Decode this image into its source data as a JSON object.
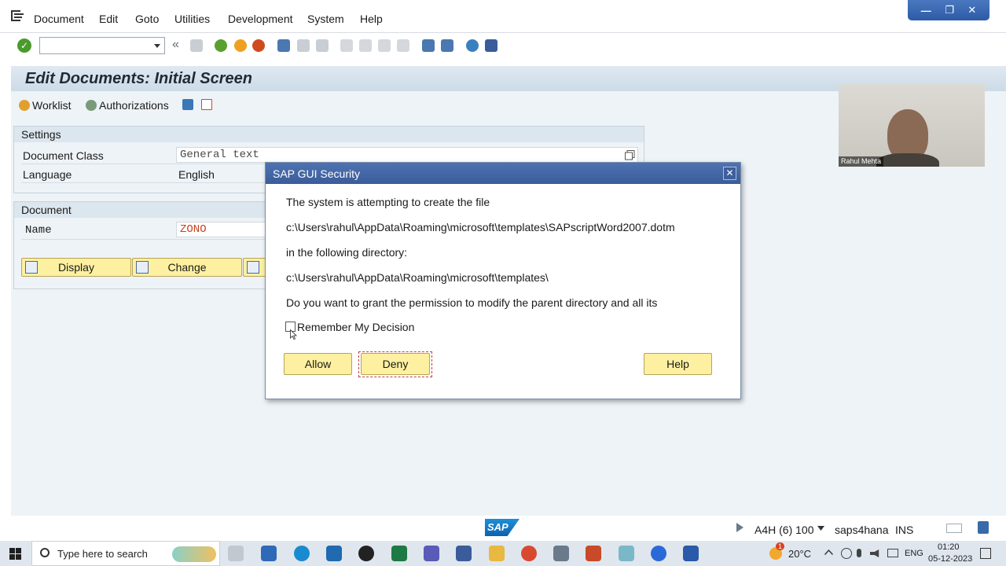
{
  "menu": {
    "items": [
      "Document",
      "Edit",
      "Goto",
      "Utilities",
      "Development",
      "System",
      "Help"
    ]
  },
  "window_controls": {
    "minimize": "—",
    "restore": "❐",
    "close": "✕"
  },
  "toolbar": {
    "command_field_value": "",
    "back_glyph": "«"
  },
  "screen": {
    "title": "Edit Documents: Initial Screen",
    "app_toolbar": {
      "worklist": "Worklist",
      "authorizations": "Authorizations"
    },
    "settings": {
      "header": "Settings",
      "document_class_label": "Document Class",
      "document_class_value": "General text",
      "language_label": "Language",
      "language_value": "English"
    },
    "document": {
      "header": "Document",
      "name_label": "Name",
      "name_value": "ZONO"
    },
    "buttons": {
      "display": "Display",
      "change": "Change"
    }
  },
  "webcam": {
    "name": "Rahul Mehta"
  },
  "dialog": {
    "title": "SAP GUI Security",
    "close_glyph": "✕",
    "line1": "The system is attempting to create the file",
    "file_path": "c:\\Users\\rahul\\AppData\\Roaming\\microsoft\\templates\\SAPscriptWord2007.dotm",
    "line2": "in the following directory:",
    "dir_path": "c:\\Users\\rahul\\AppData\\Roaming\\microsoft\\templates\\",
    "line3": "Do you want to grant the permission to modify the parent directory and all its",
    "remember_label": "Remember My Decision",
    "remember_checked": false,
    "allow": "Allow",
    "deny": "Deny",
    "help": "Help"
  },
  "statusbar": {
    "logo": "SAP",
    "system": "A4H (6) 100",
    "server": "saps4hana",
    "mode": "INS"
  },
  "taskbar": {
    "search_placeholder": "Type here to search",
    "weather": "20°C",
    "language": "ENG",
    "time": "01:20",
    "date": "05-12-2023",
    "weather_badge": "1"
  },
  "colors": {
    "sap_button_yellow": "#fdf0a0",
    "dialog_title_blue": "#3a5c9a",
    "screen_background": "#eef3f7",
    "input_red_text": "#d04020"
  }
}
